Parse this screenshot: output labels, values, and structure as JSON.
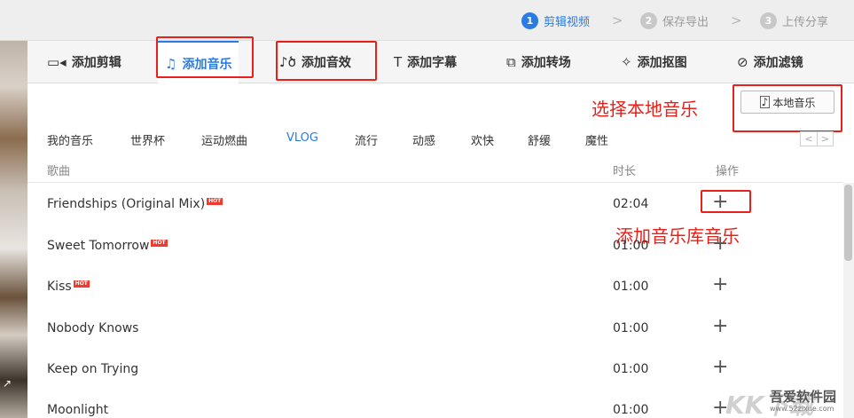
{
  "steps": [
    {
      "num": "1",
      "label": "剪辑视频"
    },
    {
      "num": "2",
      "label": "保存导出"
    },
    {
      "num": "3",
      "label": "上传分享"
    }
  ],
  "step_arrow": ">",
  "tabs": [
    {
      "label": "添加剪辑",
      "icon": "video-camera-icon",
      "glyph": "▭◂"
    },
    {
      "label": "添加音乐",
      "icon": "music-note-icon",
      "glyph": "♫"
    },
    {
      "label": "添加音效",
      "icon": "sound-effect-icon",
      "glyph": "♪ծ"
    },
    {
      "label": "添加字幕",
      "icon": "text-icon",
      "glyph": "T"
    },
    {
      "label": "添加转场",
      "icon": "transition-icon",
      "glyph": "⧉"
    },
    {
      "label": "添加抠图",
      "icon": "cutout-icon",
      "glyph": "✧"
    },
    {
      "label": "添加滤镜",
      "icon": "filter-icon",
      "glyph": "⊘"
    }
  ],
  "local_music": {
    "label": "本地音乐",
    "icon": "music-file-icon",
    "glyph": "♪"
  },
  "annotations": {
    "select_local": "选择本地音乐",
    "add_library": "添加音乐库音乐"
  },
  "categories": [
    "我的音乐",
    "世界杯",
    "运动燃曲",
    "VLOG",
    "流行",
    "动感",
    "欢快",
    "舒缓",
    "魔性"
  ],
  "pager": {
    "prev": "<",
    "next": ">"
  },
  "table": {
    "headers": {
      "title": "歌曲",
      "duration": "时长",
      "action": "操作"
    },
    "add_symbol": "+",
    "hot_label": "HOT",
    "rows": [
      {
        "title": "Friendships (Original Mix)",
        "hot": true,
        "duration": "02:04"
      },
      {
        "title": "Sweet Tomorrow",
        "hot": true,
        "duration": "01:00"
      },
      {
        "title": "Kiss",
        "hot": true,
        "duration": "01:00"
      },
      {
        "title": "Nobody Knows",
        "hot": false,
        "duration": "01:00"
      },
      {
        "title": "Keep on Trying",
        "hot": false,
        "duration": "01:00"
      },
      {
        "title": "Moonlight",
        "hot": false,
        "duration": "01:00"
      }
    ]
  },
  "watermark": {
    "logo": "KK下载",
    "name": "吾爱软件园",
    "url": "www.52zixue.com"
  },
  "colors": {
    "accent": "#2a7be4",
    "annotation": "#e8201a",
    "hot": "#f03a2f"
  }
}
